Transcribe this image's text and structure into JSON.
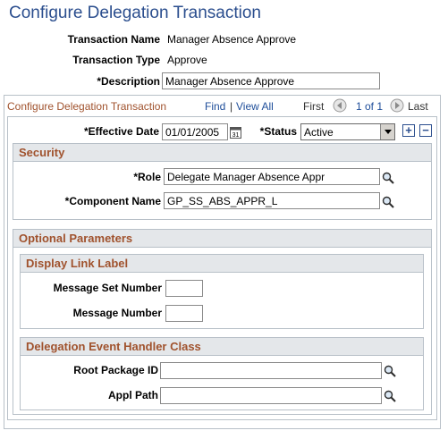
{
  "page": {
    "title": "Configure Delegation Transaction"
  },
  "header_fields": {
    "transaction_name": {
      "label": "Transaction Name",
      "value": "Manager Absence Approve"
    },
    "transaction_type": {
      "label": "Transaction Type",
      "value": "Approve"
    },
    "description": {
      "label": "*Description",
      "value": "Manager Absence Approve"
    }
  },
  "grid": {
    "title": "Configure Delegation Transaction",
    "find": "Find",
    "separator": "|",
    "view_all": "View All",
    "first": "First",
    "pager": "1 of 1",
    "last": "Last",
    "effective_date": {
      "label": "*Effective Date",
      "value": "01/01/2005"
    },
    "status": {
      "label": "*Status",
      "value": "Active"
    }
  },
  "security": {
    "title": "Security",
    "role": {
      "label": "*Role",
      "value": "Delegate Manager Absence Appr"
    },
    "component_name": {
      "label": "*Component Name",
      "value": "GP_SS_ABS_APPR_L"
    }
  },
  "optional_parameters": {
    "title": "Optional Parameters",
    "display_link_label": {
      "title": "Display Link Label",
      "message_set_number": {
        "label": "Message Set Number",
        "value": ""
      },
      "message_number": {
        "label": "Message Number",
        "value": ""
      }
    },
    "delegation_event_handler": {
      "title": "Delegation Event Handler Class",
      "root_package_id": {
        "label": "Root Package ID",
        "value": ""
      },
      "appl_path": {
        "label": "Appl Path",
        "value": ""
      }
    }
  },
  "colors": {
    "title_blue": "#2b4e8e",
    "section_brown": "#a0522d",
    "link_blue": "#1f4e9a",
    "header_gray": "#e4e7ea"
  },
  "icons": {
    "calendar": "calendar-icon",
    "lookup": "magnifier-icon",
    "prev": "arrow-left-icon",
    "next": "arrow-right-icon",
    "add": "plus-icon",
    "delete": "minus-icon"
  }
}
